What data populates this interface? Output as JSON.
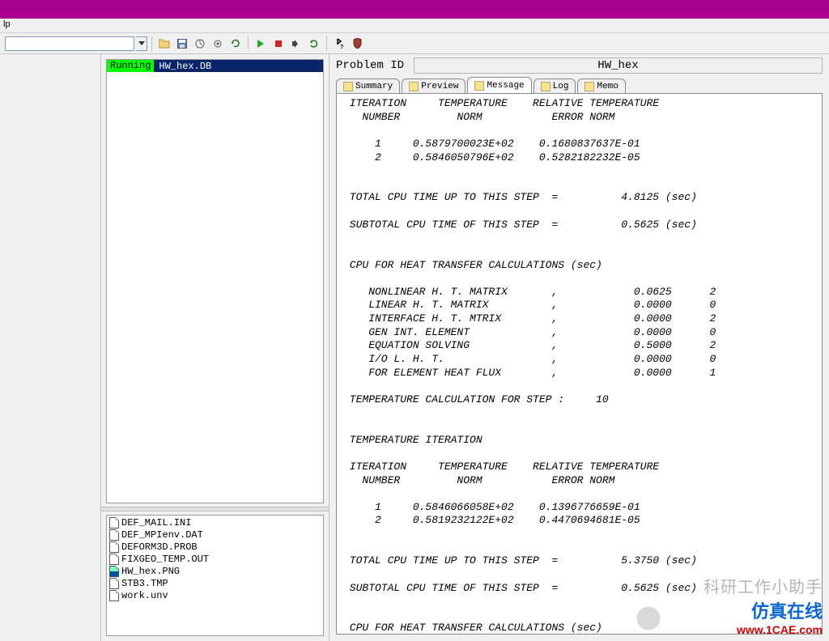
{
  "menu": {
    "help": "lp"
  },
  "toolbar": {
    "icons": [
      "folder",
      "save",
      "clock",
      "settings",
      "refresh",
      "sep",
      "play",
      "stop",
      "step-over",
      "cycle",
      "sep",
      "help",
      "shield"
    ]
  },
  "running": {
    "status": "Running",
    "file": "HW_hex.DB"
  },
  "files": [
    "DEF_MAIL.INI",
    "DEF_MPIenv.DAT",
    "DEFORM3D.PROB",
    "FIXGEO_TEMP.OUT",
    "HW_hex.PNG",
    "STB3.TMP",
    "work.unv"
  ],
  "problem": {
    "label": "Problem ID",
    "value": "HW_hex"
  },
  "tabs": [
    {
      "label": "Summary"
    },
    {
      "label": "Preview"
    },
    {
      "label": "Message",
      "active": true
    },
    {
      "label": "Log"
    },
    {
      "label": "Memo"
    }
  ],
  "message_text": " ITERATION     TEMPERATURE    RELATIVE TEMPERATURE\n   NUMBER         NORM           ERROR NORM\n\n     1     0.5879700023E+02    0.1680837637E-01\n     2     0.5846050796E+02    0.5282182232E-05\n\n\n TOTAL CPU TIME UP TO THIS STEP  =          4.8125 (sec)\n\n SUBTOTAL CPU TIME OF THIS STEP  =          0.5625 (sec)\n\n\n CPU FOR HEAT TRANSFER CALCULATIONS (sec)\n\n    NONLINEAR H. T. MATRIX       ,            0.0625      2\n    LINEAR H. T. MATRIX          ,            0.0000      0\n    INTERFACE H. T. MTRIX        ,            0.0000      2\n    GEN INT. ELEMENT             ,            0.0000      0\n    EQUATION SOLVING             ,            0.5000      2\n    I/O L. H. T.                 ,            0.0000      0\n    FOR ELEMENT HEAT FLUX        ,            0.0000      1\n\n TEMPERATURE CALCULATION FOR STEP :     10\n\n\n TEMPERATURE ITERATION\n\n ITERATION     TEMPERATURE    RELATIVE TEMPERATURE\n   NUMBER         NORM           ERROR NORM\n\n     1     0.5846066058E+02    0.1396776659E-01\n     2     0.5819232122E+02    0.4470694681E-05\n\n\n TOTAL CPU TIME UP TO THIS STEP  =          5.3750 (sec)\n\n SUBTOTAL CPU TIME OF THIS STEP  =          0.5625 (sec)\n\n\n CPU FOR HEAT TRANSFER CALCULATIONS (sec)\n\n    NONLINEAR H. T. MATRIX       ,            0.1250      2\n    LINEAR H. T. MATRIX          ,            0.0000      0\n    INTERFACE H. T. MTRIX        ,            0.0000      2\n    GEN INT. ELEMENT             ,            0.0000      0\n    EQUATION SOLVING             ,            0.4375      2\n    I/O L. H. T.                 ,            0.0000      0\n    FOR ELEMENT HEAT FLUX        ,            0.0000      1\n\n  NORMAL STOP: The assigned steps have been completed.",
  "watermark": {
    "line1": "科研工作小助手",
    "line2": "仿真在线",
    "url": "www.1CAE.com"
  }
}
